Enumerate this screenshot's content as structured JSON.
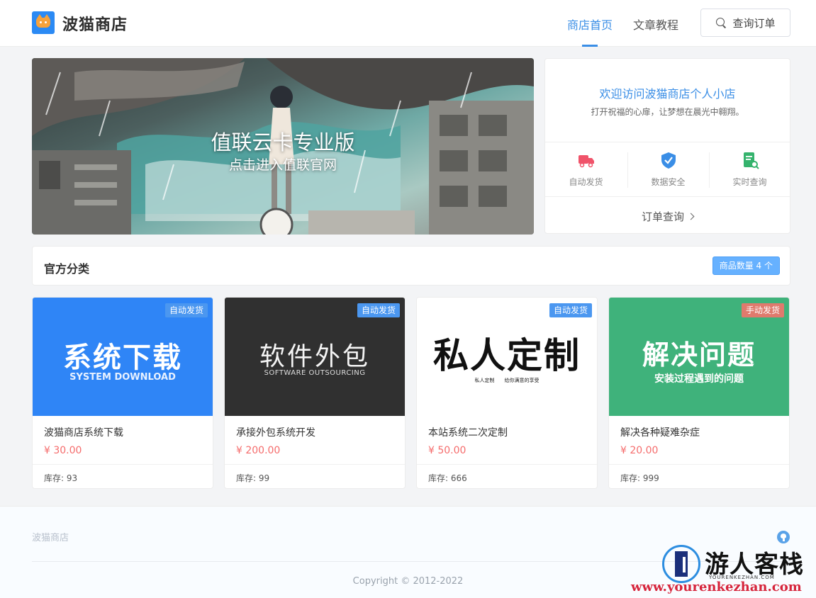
{
  "header": {
    "brand": "波猫商店",
    "nav": [
      {
        "label": "商店首页",
        "active": true
      },
      {
        "label": "文章教程",
        "active": false
      }
    ],
    "query_button": "查询订单",
    "accent": "#3a8ee6"
  },
  "banner": {
    "title": "值联云卡专业版",
    "subtitle": "点击进入值联官网"
  },
  "welcome": {
    "title": "欢迎访问波猫商店个人小店",
    "subtitle": "打开祝福的心扉，让梦想在晨光中翱翔。",
    "features": [
      {
        "label": "自动发货",
        "icon": "truck-icon"
      },
      {
        "label": "数据安全",
        "icon": "shield-icon"
      },
      {
        "label": "实时查询",
        "icon": "document-search-icon"
      }
    ],
    "link": "订单查询"
  },
  "categories": {
    "title": "官方分类",
    "count_label": "商品数量 4 个"
  },
  "products": [
    {
      "thumb_main": "系统下载",
      "thumb_sub": "SYSTEM DOWNLOAD",
      "thumb_bg": "#2f85f6",
      "badge": "自动发货",
      "name": "波猫商店系统下载",
      "price": "¥ 30.00",
      "stock": "库存: 93"
    },
    {
      "thumb_main": "软件外包",
      "thumb_sub": "SOFTWARE OUTSOURCING",
      "thumb_bg": "#303030",
      "badge": "自动发货",
      "name": "承接外包系统开发",
      "price": "¥ 200.00",
      "stock": "库存: 99"
    },
    {
      "thumb_main": "私人定制",
      "thumb_sub": "私人定制　　给你满意的享受",
      "thumb_bg": "#ffffff",
      "badge": "自动发货",
      "name": "本站系统二次定制",
      "price": "¥ 50.00",
      "stock": "库存: 666"
    },
    {
      "thumb_main": "解决问题",
      "thumb_sub": "安装过程遇到的问题",
      "thumb_bg": "#3fb27b",
      "badge": "手动发货",
      "name": "解决各种疑难杂症",
      "price": "¥ 20.00",
      "stock": "库存: 999"
    }
  ],
  "footer": {
    "brand": "波猫商店",
    "copyright": "Copyright © 2012-2022"
  },
  "watermark": {
    "name": "游人客栈",
    "en": "YOURENKEZHAN.COM",
    "url": "www.yourenkezhan.com"
  }
}
